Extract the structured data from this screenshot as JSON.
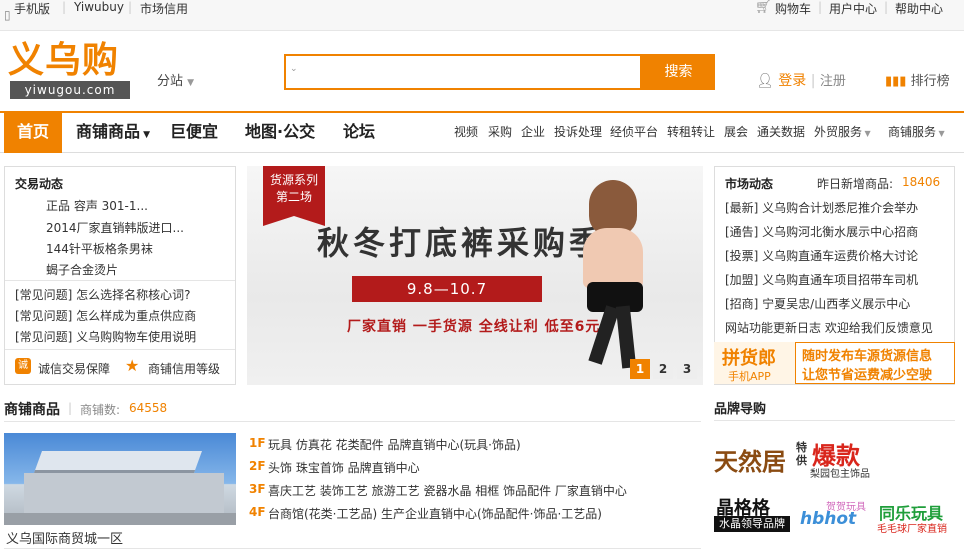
{
  "topbar": {
    "mobile": "手机版",
    "yiwubuy": "Yiwubuy",
    "credit": "市场信用",
    "cart": "购物车",
    "user_center": "用户中心",
    "help_center": "帮助中心"
  },
  "header": {
    "logo_cn": "义乌购",
    "logo_en": "yiwugou.com",
    "substation": "分站",
    "search_placeholder": "",
    "search_button": "搜索",
    "login": "登录",
    "register": "注册",
    "ranking": "排行榜"
  },
  "nav": {
    "home": "首页",
    "main": [
      "商铺商品",
      "巨便宜",
      "地图·公交",
      "论坛"
    ],
    "sub": [
      "视频",
      "采购",
      "企业",
      "投诉处理",
      "经侦平台",
      "转租转让",
      "展会",
      "通关数据",
      "外贸服务",
      "商铺服务"
    ]
  },
  "trade": {
    "title": "交易动态",
    "items": [
      "正品 容声 301-1...",
      "2014厂家直销韩版进口...",
      "144针平板格条男袜",
      "蝎子合金烫片"
    ],
    "faq": [
      "[常见问题] 怎么选择名称核心词?",
      "[常见问题] 怎么样成为重点供应商",
      "[常见问题] 义乌购购物车使用说明"
    ],
    "footer": [
      "诚信交易保障",
      "商铺信用等级"
    ]
  },
  "banner": {
    "ribbon_line1": "货源系列",
    "ribbon_line2": "第二场",
    "title": "秋冬打底裤采购季",
    "date": "9.8—10.7",
    "slogan": "厂家直销  一手货源  全线让利  低至6元",
    "pages": [
      "1",
      "2",
      "3"
    ],
    "active_page": 1
  },
  "market": {
    "title": "市场动态",
    "new_label": "昨日新增商品:",
    "new_count": "18406",
    "items": [
      "[最新] 义乌购合计划悉尼推介会举办",
      "[通告] 义乌购河北衡水展示中心招商",
      "[投票] 义乌购直通车运费价格大讨论",
      "[加盟] 义乌购直通车项目招带车司机",
      "[招商] 宁夏吴忠/山西孝义展示中心",
      "网站功能更新日志  欢迎给我们反馈意见"
    ],
    "pinhuolang_brand": "拼货郎",
    "pinhuolang_app": "手机APP",
    "pinhuolang_slogan1": "随时发布车源货源信息",
    "pinhuolang_slogan2": "让您节省运费减少空驶"
  },
  "shops": {
    "title": "商铺商品",
    "count_label": "商铺数:",
    "count": "64558",
    "photo_caption": "义乌国际商贸城一区",
    "floors": [
      {
        "floor": "1F",
        "items": "玩具   仿真花   花类配件   品牌直销中心(玩具·饰品)"
      },
      {
        "floor": "2F",
        "items": "头饰   珠宝首饰   品牌直销中心"
      },
      {
        "floor": "3F",
        "items": "喜庆工艺   装饰工艺   旅游工艺   瓷器水晶   相框   饰品配件   厂家直销中心"
      },
      {
        "floor": "4F",
        "items": "台商馆(花类·工艺品)   生产企业直销中心(饰品配件·饰品·工艺品)"
      }
    ]
  },
  "brands": {
    "title": "品牌导购",
    "b1": "天然居",
    "b2_top": "特供",
    "b2": "爆款",
    "b2_sub": "梨园包主饰品",
    "b3": "晶格格",
    "b3_sub": "水晶领导品牌",
    "b4": "hbhot",
    "b4_top": "贺贺玩具",
    "b5": "同乐玩具",
    "b5_sub": "毛毛球厂家直销"
  },
  "colors": {
    "accent": "#f08200",
    "red": "#b31b1b"
  }
}
